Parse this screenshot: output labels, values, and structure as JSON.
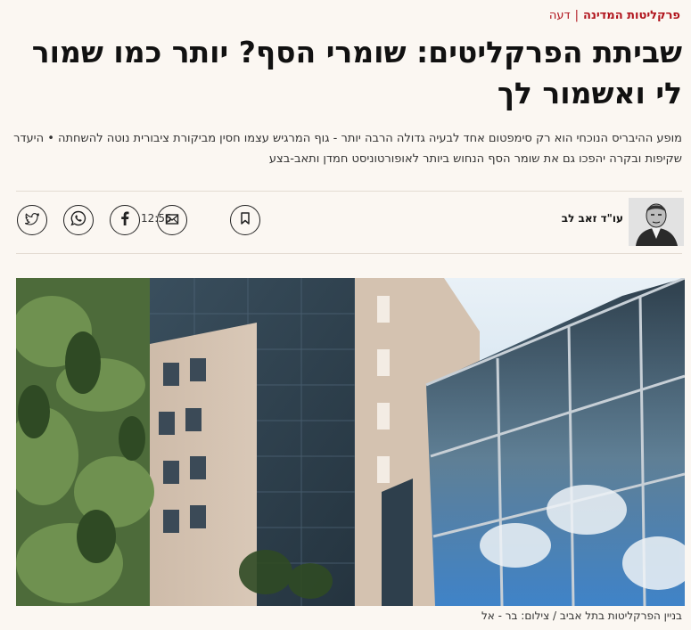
{
  "breadcrumb": {
    "section": "פרקליטות המדינה",
    "separator": "|",
    "category": "דעה"
  },
  "article": {
    "title": "שביתת הפרקליטים: שומרי הסף? יותר כמו שמור לי ואשמור לך",
    "subtitle": "מופע ההיבריס הנוכחי הוא רק סימפטום אחד לבעיה גדולה הרבה יותר - גוף המרגיש עצמו חסין מביקורת ציבורית נוטה להשחתה • היעדר שקיפות ובקרה יהפכו גם את שומר הסף הנחוש ביותר לאופורטוניסט חמדן ותאב-בצע",
    "author": "עו\"ד זאב לב",
    "time": "12:56",
    "caption": "בניין הפרקליטות בתל אביב / צילום: בר - אל"
  },
  "share_icons": [
    "bookmark-icon",
    "email-icon",
    "facebook-icon",
    "whatsapp-icon",
    "twitter-icon"
  ],
  "colors": {
    "accent": "#b0121b",
    "background": "#fbf7f2"
  }
}
